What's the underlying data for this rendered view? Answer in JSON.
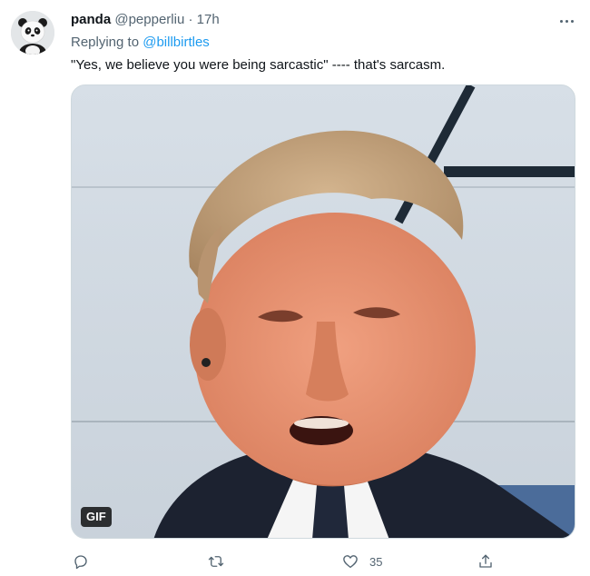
{
  "tweet": {
    "display_name": "panda",
    "handle": "@pepperliu",
    "separator": "·",
    "time": "17h",
    "reply_prefix": "Replying to",
    "reply_mention": "@billbirtles",
    "text": "\"Yes, we believe you were being sarcastic\" ---- that's sarcasm.",
    "media": {
      "badge": "GIF"
    },
    "actions": {
      "reply": {
        "icon": "reply-icon",
        "count": ""
      },
      "retweet": {
        "icon": "retweet-icon",
        "count": ""
      },
      "like": {
        "icon": "heart-icon",
        "count": "35"
      },
      "share": {
        "icon": "share-icon",
        "count": ""
      }
    }
  },
  "colors": {
    "text": "#0f1419",
    "secondary": "#536471",
    "link": "#1d9bf0",
    "border": "#cfd9de"
  }
}
